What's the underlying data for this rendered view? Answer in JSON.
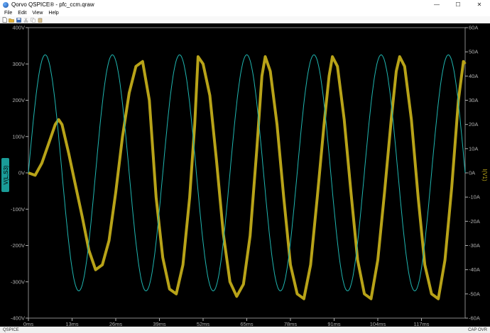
{
  "window": {
    "title": "Qorvo QSPICE® - pfc_ccm.qraw",
    "minimize_glyph": "—",
    "maximize_glyph": "☐",
    "close_glyph": "✕"
  },
  "menu": [
    "File",
    "Edit",
    "View",
    "Help"
  ],
  "toolbar_icons": [
    "new-icon",
    "open-icon",
    "save-icon",
    "cut-icon",
    "copy-icon",
    "paste-icon"
  ],
  "status": {
    "left": "QSPICE",
    "right": "CAP OVR"
  },
  "colors": {
    "left_trace": "#1fb5b0",
    "right_trace": "#b8a318",
    "axis": "#b0b0b0",
    "background": "#000000"
  },
  "chart_data": {
    "type": "line",
    "xlabel": "",
    "x_ticks": [
      "0ms",
      "13ms",
      "26ms",
      "39ms",
      "52ms",
      "65ms",
      "78ms",
      "91ms",
      "104ms",
      "117ms"
    ],
    "xlim": [
      0,
      130
    ],
    "y_left": {
      "ticks": [
        "400V",
        "300V",
        "200V",
        "100V",
        "0V",
        "-100V",
        "-200V",
        "-300V",
        "-400V"
      ],
      "ylim": [
        -400,
        400
      ],
      "label": "V(L,S3)"
    },
    "y_right": {
      "ticks": [
        "60A",
        "50A",
        "40A",
        "30A",
        "20A",
        "10A",
        "0A",
        "-10A",
        "-20A",
        "-30A",
        "-40A",
        "-50A",
        "-60A"
      ],
      "ylim": [
        -60,
        60
      ],
      "label": "I(V1)"
    },
    "series": [
      {
        "name": "V(L,S3)",
        "axis": "left",
        "kind": "sine",
        "amplitude": 325,
        "frequency_hz": 50,
        "phase_deg": 0
      },
      {
        "name": "I(V1)",
        "axis": "right",
        "kind": "keypoints",
        "x": [
          0,
          2,
          4,
          6,
          8,
          9,
          10,
          12,
          14,
          16,
          18,
          20,
          22,
          24,
          26,
          28,
          30,
          32,
          34,
          36,
          38,
          40,
          42,
          44,
          46,
          48,
          49.5,
          50.5,
          52,
          54,
          56,
          58,
          60,
          62,
          64,
          66,
          68,
          69.5,
          70.5,
          72,
          74,
          76,
          78,
          80,
          82,
          84,
          86,
          88,
          89.5,
          90.5,
          92,
          94,
          96,
          98,
          100,
          102,
          104,
          106,
          108,
          109.5,
          110.5,
          112,
          114,
          116,
          118,
          120,
          122,
          124,
          126,
          128,
          129.5,
          130
        ],
        "y": [
          0,
          -1,
          4,
          12,
          20,
          22,
          20,
          8,
          -5,
          -18,
          -32,
          -40,
          -38,
          -28,
          -8,
          15,
          33,
          44,
          46,
          30,
          -10,
          -35,
          -48,
          -50,
          -38,
          -10,
          20,
          48,
          45,
          32,
          5,
          -25,
          -45,
          -51,
          -46,
          -26,
          10,
          40,
          48,
          42,
          20,
          -10,
          -38,
          -50,
          -52,
          -38,
          -10,
          20,
          40,
          48,
          44,
          22,
          -8,
          -36,
          -50,
          -52,
          -36,
          -8,
          22,
          42,
          48,
          44,
          22,
          -10,
          -38,
          -50,
          -52,
          -36,
          -6,
          30,
          46,
          45
        ]
      }
    ]
  }
}
